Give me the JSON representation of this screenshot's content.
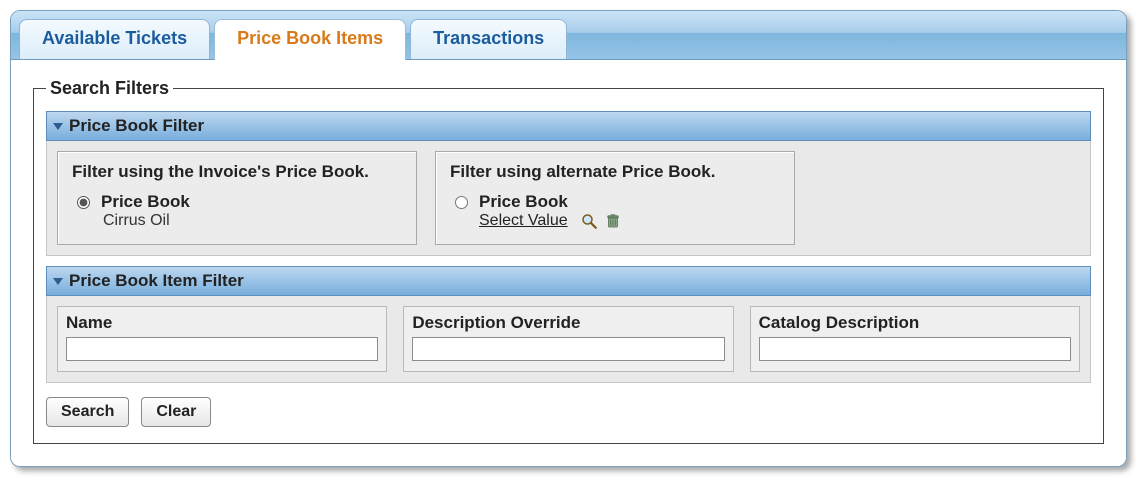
{
  "tabs": {
    "available_tickets": "Available Tickets",
    "price_book_items": "Price Book Items",
    "transactions": "Transactions"
  },
  "search_filters": {
    "legend": "Search Filters",
    "price_book_filter": {
      "header": "Price Book Filter",
      "invoice_box": {
        "title": "Filter using the Invoice's Price Book.",
        "radio_label": "Price Book",
        "value": "Cirrus Oil"
      },
      "alternate_box": {
        "title": "Filter using alternate Price Book.",
        "radio_label": "Price Book",
        "select_value_text": "Select Value"
      }
    },
    "item_filter": {
      "header": "Price Book Item Filter",
      "name_label": "Name",
      "name_value": "",
      "desc_override_label": "Description Override",
      "desc_override_value": "",
      "catalog_desc_label": "Catalog Description",
      "catalog_desc_value": ""
    },
    "buttons": {
      "search": "Search",
      "clear": "Clear"
    }
  }
}
